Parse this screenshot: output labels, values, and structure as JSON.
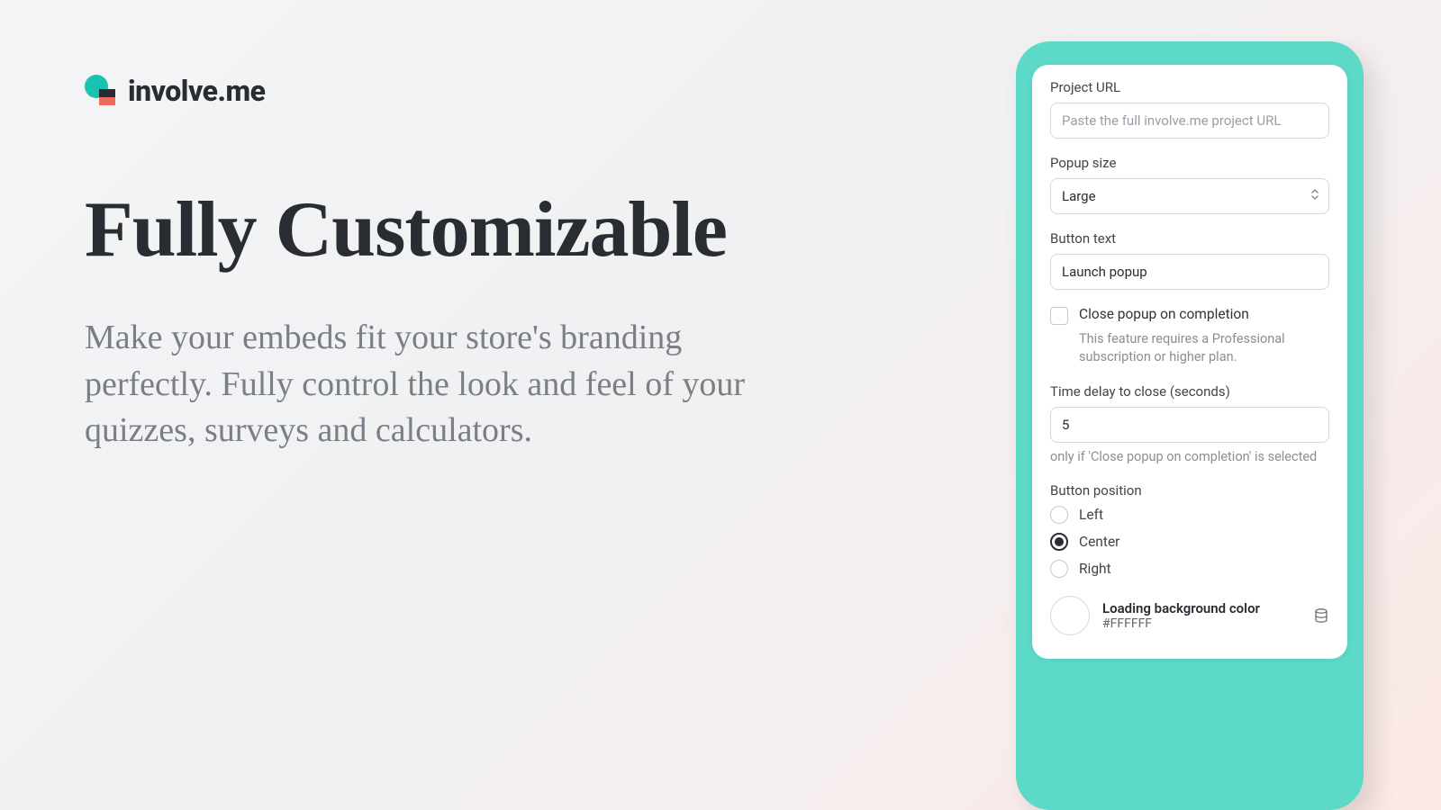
{
  "brand": {
    "name": "involve.me"
  },
  "hero": {
    "title": "Fully Customizable",
    "subtitle": "Make your embeds fit your store's branding perfectly. Fully control the look and feel of your quizzes, surveys and calculators."
  },
  "form": {
    "project_url": {
      "label": "Project URL",
      "placeholder": "Paste the full involve.me project URL"
    },
    "popup_size": {
      "label": "Popup size",
      "value": "Large"
    },
    "button_text": {
      "label": "Button text",
      "value": "Launch popup"
    },
    "close_on_completion": {
      "label": "Close popup on completion",
      "note": "This feature requires a Professional subscription or higher plan."
    },
    "time_delay": {
      "label": "Time delay to close (seconds)",
      "value": "5",
      "note": "only if 'Close popup on completion' is selected"
    },
    "button_position": {
      "label": "Button position",
      "options": [
        "Left",
        "Center",
        "Right"
      ],
      "selected": "Center"
    },
    "loading_bg": {
      "label": "Loading background color",
      "value": "#FFFFFF"
    }
  }
}
